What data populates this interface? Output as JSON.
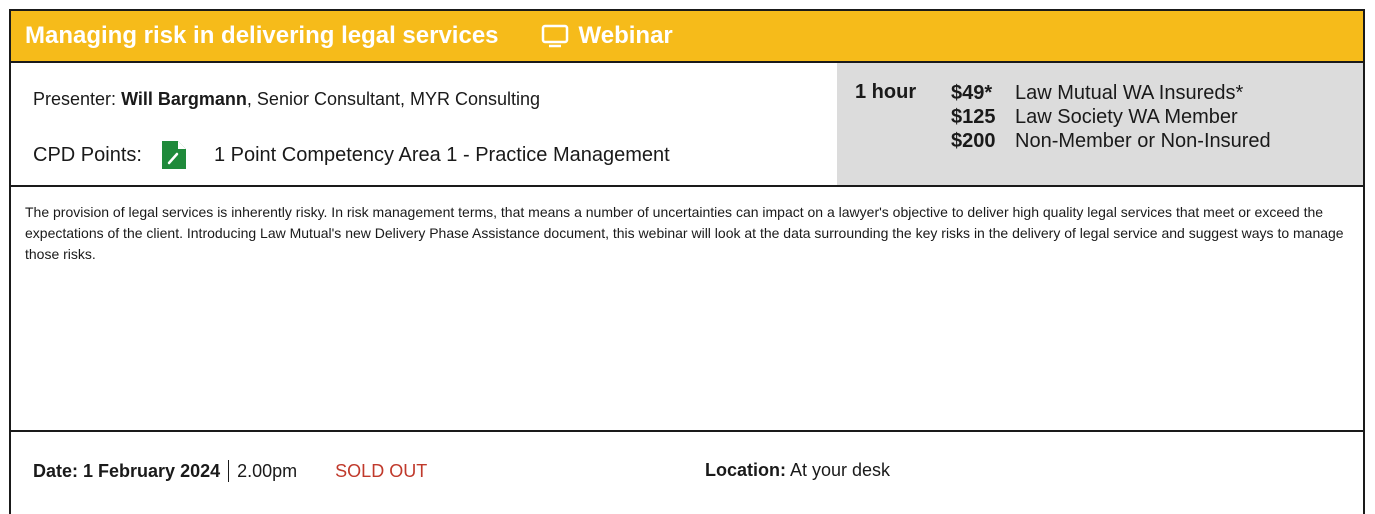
{
  "header": {
    "title": "Managing risk in delivering legal services",
    "type_label": "Webinar",
    "type_icon": "monitor-icon",
    "bg_color": "#f6bb1a"
  },
  "presenter": {
    "label": "Presenter:",
    "name": "Will Bargmann",
    "role": ", Senior Consultant, MYR Consulting"
  },
  "cpd": {
    "label": "CPD Points:",
    "icon": "document-edit-icon",
    "text": "1 Point Competency Area 1 - Practice Management",
    "icon_color": "#1f8a3b"
  },
  "duration": "1 hour",
  "prices": [
    {
      "amount": "$49*",
      "label": "Law Mutual WA Insureds*"
    },
    {
      "amount": "$125",
      "label": "Law Society WA Member"
    },
    {
      "amount": "$200",
      "label": "Non-Member or Non-Insured"
    }
  ],
  "description": "The provision of legal services is inherently risky. In risk management terms, that means a number of uncertainties can impact on a lawyer's objective to deliver high quality legal services that meet or exceed the expectations of the client. Introducing  Law Mutual's new Delivery Phase Assistance document, this webinar will look at the data surrounding the key risks in the delivery of legal service and suggest ways to manage those risks.",
  "footer": {
    "date_label": "Date:",
    "date_value": "1 February 2024",
    "time": "2.00pm",
    "status": "SOLD OUT",
    "status_color": "#c0392b",
    "location_label": "Location:",
    "location_value": "At your desk"
  }
}
